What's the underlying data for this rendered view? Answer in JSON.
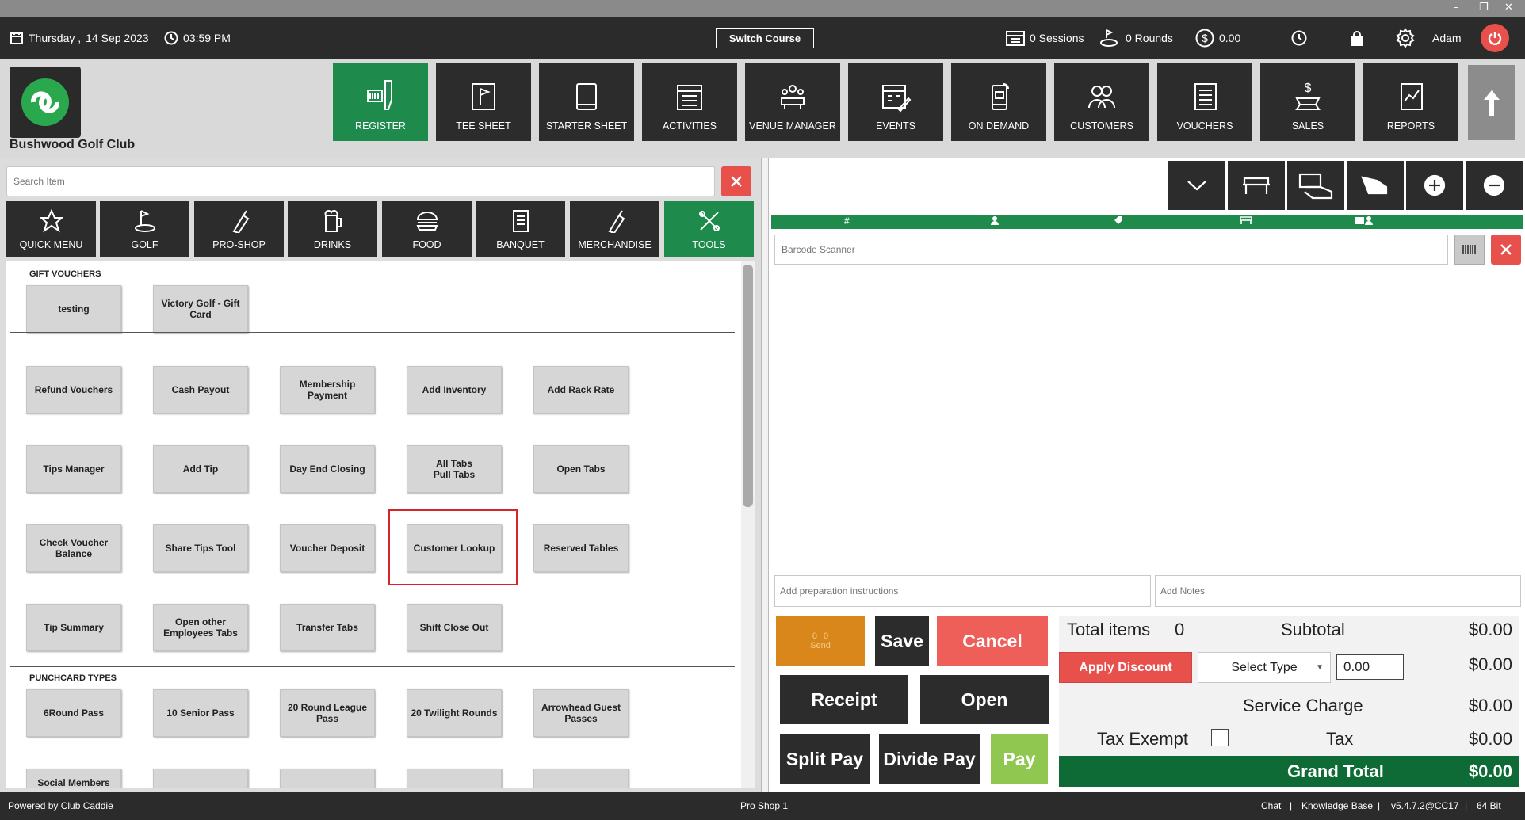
{
  "topbar": {
    "day": "Thursday ,",
    "date": "14 Sep 2023",
    "time": "03:59 PM",
    "switch_course": "Switch Course",
    "sessions": "0 Sessions",
    "rounds": "0 Rounds",
    "cash": "0.00",
    "user": "Adam"
  },
  "club": {
    "name": "Bushwood Golf Club"
  },
  "nav": [
    {
      "label": "REGISTER",
      "icon": "barcode-scanner-icon"
    },
    {
      "label": "TEE SHEET",
      "icon": "tee-sheet-icon"
    },
    {
      "label": "STARTER SHEET",
      "icon": "tablet-icon"
    },
    {
      "label": "ACTIVITIES",
      "icon": "activities-icon"
    },
    {
      "label": "VENUE MANAGER",
      "icon": "venue-icon"
    },
    {
      "label": "EVENTS",
      "icon": "events-icon"
    },
    {
      "label": "ON DEMAND",
      "icon": "phone-icon"
    },
    {
      "label": "CUSTOMERS",
      "icon": "customers-icon"
    },
    {
      "label": "VOUCHERS",
      "icon": "vouchers-icon"
    },
    {
      "label": "SALES",
      "icon": "sales-icon"
    },
    {
      "label": "REPORTS",
      "icon": "reports-icon"
    }
  ],
  "search": {
    "placeholder": "Search Item"
  },
  "categories": [
    "QUICK MENU",
    "GOLF",
    "PRO-SHOP",
    "DRINKS",
    "FOOD",
    "BANQUET",
    "MERCHANDISE",
    "TOOLS"
  ],
  "sections": {
    "gift_vouchers": "GIFT VOUCHERS",
    "punchcard_types": "PUNCHCARD TYPES"
  },
  "gift_tiles": [
    "testing",
    "Victory Golf - Gift Card"
  ],
  "tool_tiles": [
    "Refund Vouchers",
    "Cash Payout",
    "Membership Payment",
    "Add Inventory",
    "Add Rack Rate",
    "Tips Manager",
    "Add Tip",
    "Day End Closing",
    "All Tabs\nPull Tabs",
    "Open Tabs",
    "Check Voucher Balance",
    "Share Tips Tool",
    "Voucher Deposit",
    "Customer Lookup",
    "Reserved Tables",
    "Tip Summary",
    "Open other Employees Tabs",
    "Transfer Tabs",
    "Shift Close Out"
  ],
  "punch_tiles": [
    "6Round Pass",
    "10 Senior Pass",
    "20 Round League Pass",
    "20 Twilight Rounds",
    "Arrowhead Guest Passes",
    "Social Members"
  ],
  "order": {
    "barcode_placeholder": "Barcode Scanner",
    "prep_placeholder": "Add preparation instructions",
    "notes_placeholder": "Add Notes",
    "header_hash": "#"
  },
  "actions": {
    "send_count1": "0",
    "send_count2": "0",
    "send": "Send",
    "save": "Save",
    "cancel": "Cancel",
    "receipt": "Receipt",
    "open": "Open",
    "split_pay": "Split Pay",
    "divide_pay": "Divide Pay",
    "pay": "Pay"
  },
  "totals": {
    "total_items_label": "Total items",
    "total_items": "0",
    "subtotal_label": "Subtotal",
    "subtotal": "$0.00",
    "apply_discount": "Apply Discount",
    "select_type": "Select Type",
    "discount_value": "0.00",
    "discount_amount": "$0.00",
    "service_charge_label": "Service Charge",
    "service_charge": "$0.00",
    "tax_exempt_label": "Tax Exempt",
    "tax_label": "Tax",
    "tax": "$0.00",
    "grand_total_label": "Grand Total",
    "grand_total": "$0.00"
  },
  "status": {
    "powered": "Powered by Club Caddie",
    "station": "Pro Shop 1",
    "chat": "Chat",
    "sep": "|",
    "kb": "Knowledge Base",
    "version": "v5.4.7.2@CC17",
    "bits": "64 Bit"
  },
  "colors": {
    "brand_green": "#1e8a4c",
    "danger": "#e8504c",
    "send_orange": "#d9871b",
    "pay_green": "#8fc751"
  }
}
